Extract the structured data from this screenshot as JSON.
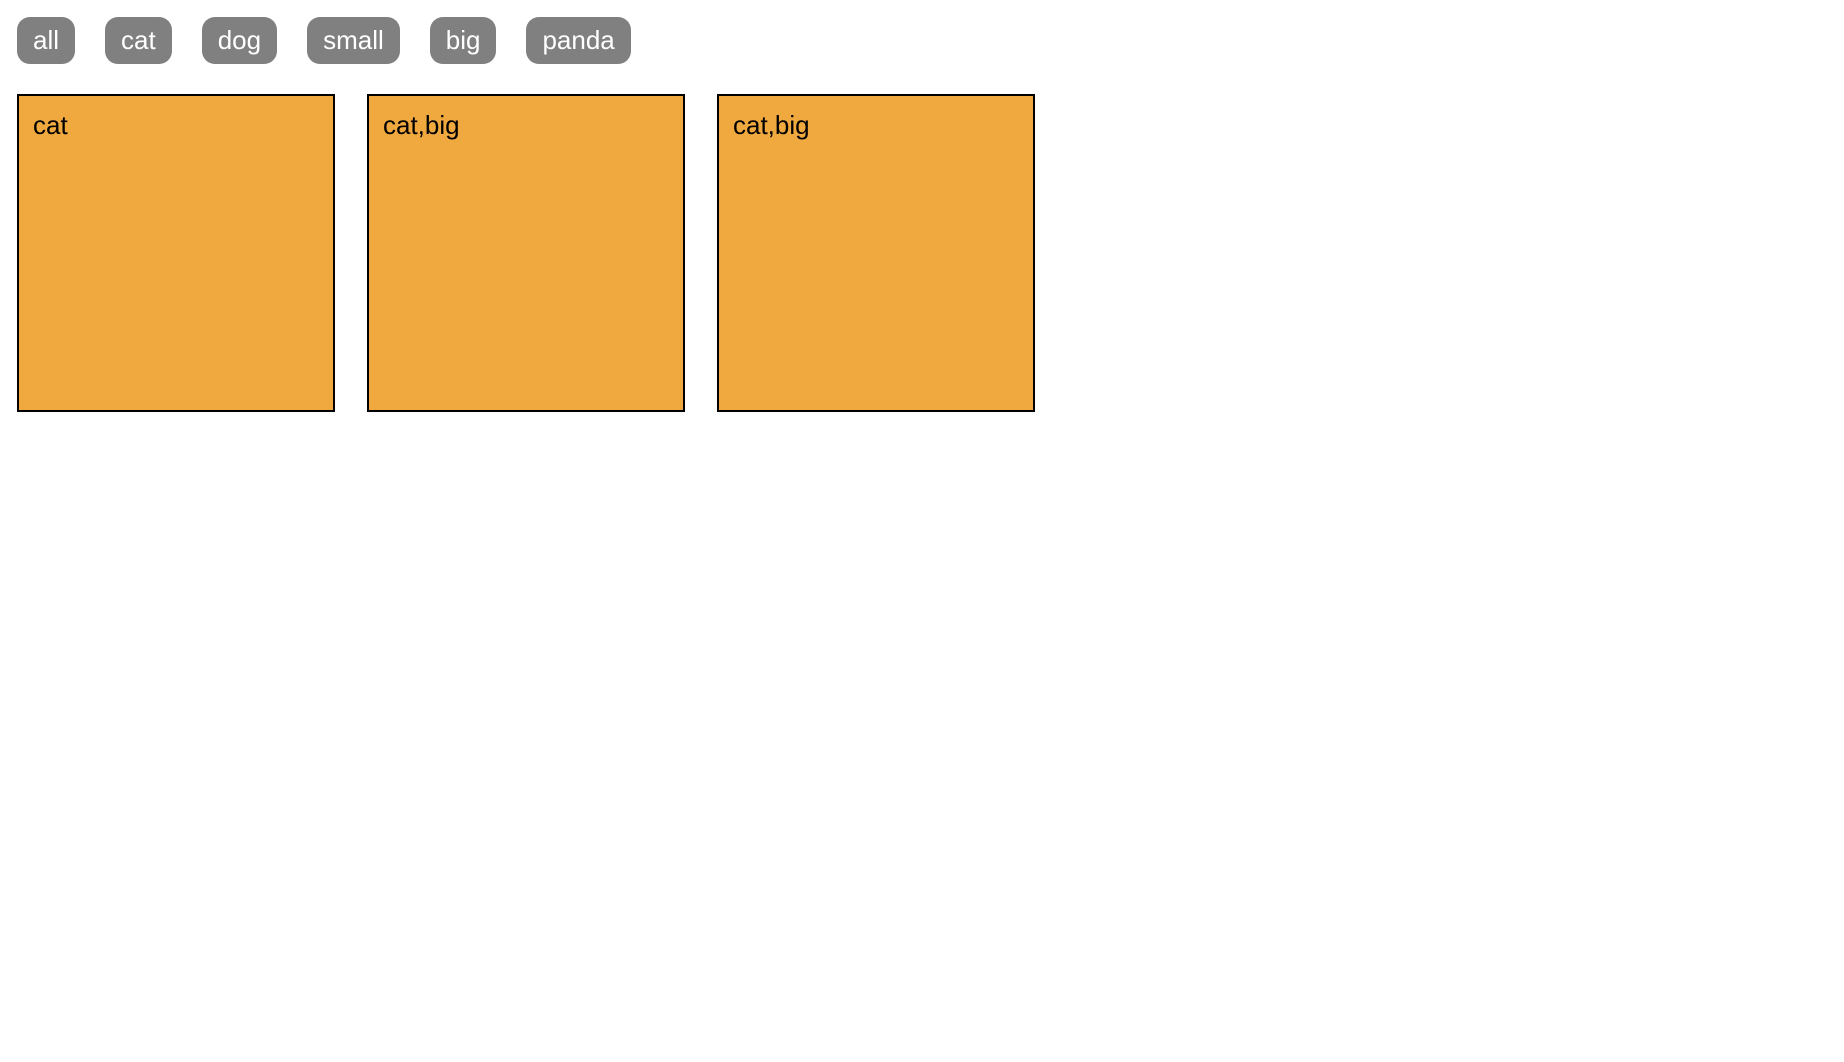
{
  "filters": {
    "items": [
      {
        "label": "all"
      },
      {
        "label": "cat"
      },
      {
        "label": "dog"
      },
      {
        "label": "small"
      },
      {
        "label": "big"
      },
      {
        "label": "panda"
      }
    ]
  },
  "cards": {
    "items": [
      {
        "label": "cat"
      },
      {
        "label": "cat,big"
      },
      {
        "label": "cat,big"
      }
    ]
  },
  "colors": {
    "card_bg": "#f0a93e",
    "filter_bg": "#808080",
    "filter_fg": "#ffffff"
  }
}
